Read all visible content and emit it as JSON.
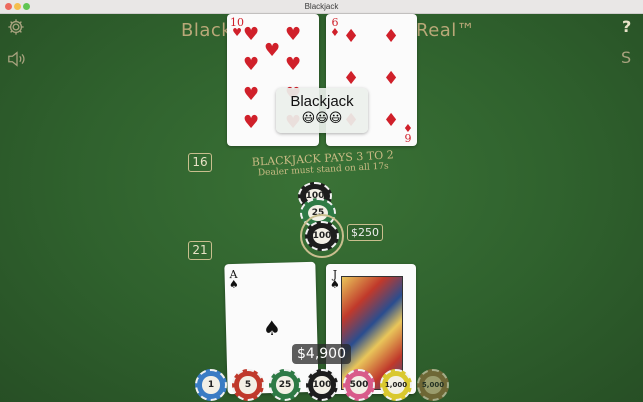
{
  "window": {
    "title": "Blackjack"
  },
  "table": {
    "title_left": "Blackc",
    "title_right": "Real™",
    "pays_text": "BLACKJACK PAYS 3 TO 2",
    "dealer_rule": "Dealer must stand on all 17s"
  },
  "icons": {
    "settings": "gear-icon",
    "sound": "speaker-icon",
    "help": "question-mark-icon",
    "currency": "dollar-icon"
  },
  "help_label": "?",
  "currency_label": "S",
  "dealer": {
    "score": "16",
    "cards": [
      {
        "rank": "10",
        "suit": "♥",
        "color": "#d0202a"
      },
      {
        "rank": "6",
        "suit": "♦",
        "color": "#d0202a"
      }
    ]
  },
  "result": {
    "label": "Blackjack",
    "emojis": "😃😃😃"
  },
  "bet": {
    "amount_label": "$250",
    "chips": [
      {
        "value": "100",
        "color": "#1d1d1d"
      },
      {
        "value": "25",
        "color": "#2e7a45"
      },
      {
        "value": "100",
        "color": "#1d1d1d"
      }
    ]
  },
  "player": {
    "score": "21",
    "cards": [
      {
        "rank": "A",
        "suit": "♠",
        "color": "#111111"
      },
      {
        "rank": "J",
        "suit": "♠",
        "color": "#111111"
      }
    ]
  },
  "balance": "$4,900",
  "chip_rack": [
    {
      "value": "1",
      "color": "#3a7cc4"
    },
    {
      "value": "5",
      "color": "#c0392b"
    },
    {
      "value": "25",
      "color": "#2e7a45"
    },
    {
      "value": "100",
      "color": "#1d1d1d"
    },
    {
      "value": "500",
      "color": "#d85b8a"
    },
    {
      "value": "1,000",
      "color": "#d9c82f"
    },
    {
      "value": "5,000",
      "color": "#8a6d3b"
    }
  ]
}
